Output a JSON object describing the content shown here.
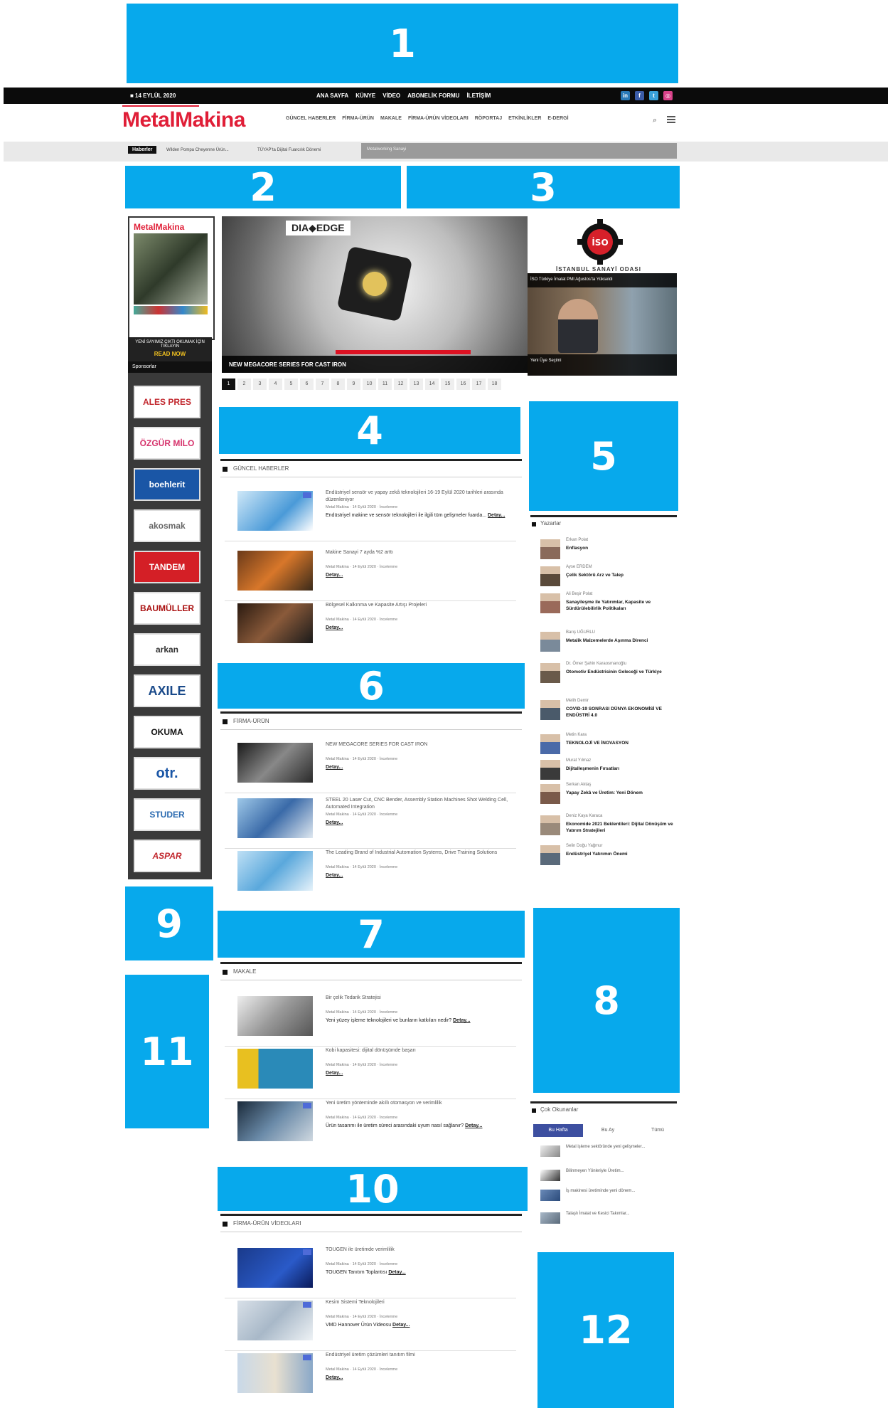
{
  "markers": [
    "1",
    "2",
    "3",
    "4",
    "5",
    "6",
    "7",
    "8",
    "9",
    "10",
    "11",
    "12"
  ],
  "colors": {
    "accent_blue": "#07a9ec",
    "brand_red": "#e01e37",
    "tab_active": "#3d4fa0"
  },
  "topbar": {
    "date": "■ 14 EYLÜL 2020",
    "nav": [
      "ANA SAYFA",
      "KÜNYE",
      "VİDEO",
      "ABONELİK FORMU",
      "İLETİŞİM"
    ],
    "social_icons": [
      "linkedin-icon",
      "facebook-icon",
      "twitter-icon",
      "instagram-icon"
    ]
  },
  "header": {
    "logo": "MetalMakina",
    "nav": [
      "GÜNCEL HABERLER",
      "FİRMA-ÜRÜN",
      "MAKALE",
      "FİRMA-ÜRÜN VİDEOLARI",
      "RÖPORTAJ",
      "ETKİNLİKLER",
      "E-DERGİ"
    ]
  },
  "ticker": {
    "label": "Haberler",
    "items": [
      "Wilden Pompa Cheyenne Ürün...",
      "TÜYAP’ta Dijital Fuarcılık Dönemi"
    ],
    "gray_text": "Metalworking Sanayi"
  },
  "magazine": {
    "title": "MetalMakina",
    "caption": "YENİ SAYIMIZ ÇIKTI OKUMAK İÇİN TIKLAYIN",
    "read": "READ NOW"
  },
  "sponsors": {
    "heading": "Sponsorlar",
    "logos": [
      "ALES PRES",
      "ÖZGÜR MİLO",
      "boehlerit",
      "akosmak",
      "TANDEM",
      "BAUMÜLLER",
      "arkan",
      "AXILE",
      "OKUMA",
      "otr.",
      "STUDER",
      "ASPAR"
    ]
  },
  "hero": {
    "brand": "DIA◆EDGE",
    "caption": "NEW MEGACORE SERIES FOR CAST IRON",
    "pages": [
      "1",
      "2",
      "3",
      "4",
      "5",
      "6",
      "7",
      "8",
      "9",
      "10",
      "11",
      "12",
      "13",
      "14",
      "15",
      "16",
      "17",
      "18"
    ]
  },
  "iso": {
    "text": "İSTANBUL SANAYİ ODASI",
    "video_title": "İSO Türkiye İmalat PMI Ağustos’ta Yükseldi",
    "video_caption": "Yeni Üye Seçimi"
  },
  "sections": {
    "guncel": {
      "heading": "GÜNCEL HABERLER",
      "articles": [
        {
          "title": "Endüstriyel sensör ve yapay zekâ teknolojileri 16-19 Eylül 2020 tarihleri arasında düzenleniyor",
          "meta": "Metal Makina  ·  14 Eylül 2020  ·  İncelenme",
          "summary": "Endüstriyel makine ve sensör teknolojileri ile ilgili tüm gelişmeler fuarda...",
          "detail": "Detay..."
        },
        {
          "title": "Makine Sanayi 7 ayda %2 arttı",
          "meta": "Metal Makina  ·  14 Eylül 2020  ·  İncelenme",
          "summary": "",
          "detail": "Detay..."
        },
        {
          "title": "Bölgesel Kalkınma ve Kapasite Artışı Projeleri",
          "meta": "Metal Makina  ·  14 Eylül 2020  ·  İncelenme",
          "summary": "",
          "detail": "Detay..."
        }
      ]
    },
    "firma": {
      "heading": "FİRMA-ÜRÜN",
      "articles": [
        {
          "title": "NEW MEGACORE SERIES FOR CAST IRON",
          "meta": "Metal Makina  ·  14 Eylül 2020  ·  İncelenme",
          "summary": "",
          "detail": "Detay..."
        },
        {
          "title": "STEEL 20 Laser Cut, CNC Bender, Assembly Station Machines Shot Welding Cell, Automated Integration",
          "meta": "Metal Makina  ·  14 Eylül 2020  ·  İncelenme",
          "summary": "",
          "detail": "Detay..."
        },
        {
          "title": "The Leading Brand of Industrial Automation Systems, Drive Training Solutions",
          "meta": "Metal Makina  ·  14 Eylül 2020  ·  İncelenme",
          "summary": "",
          "detail": "Detay..."
        }
      ]
    },
    "makale": {
      "heading": "MAKALE",
      "articles": [
        {
          "title": "Bir çelik Tedarik Stratejisi",
          "meta": "Metal Makina  ·  14 Eylül 2020  ·  İncelenme",
          "summary": "Yeni yüzey işleme teknolojileri ve bunların katkıları nedir?",
          "detail": "Detay..."
        },
        {
          "title": "Kobi kapasitesi: dijital dönüşümde başarı",
          "meta": "Metal Makina  ·  14 Eylül 2020  ·  İncelenme",
          "summary": "",
          "detail": "Detay..."
        },
        {
          "title": "Yeni üretim yönteminde akıllı otomasyon ve verimlilik",
          "meta": "Metal Makina  ·  14 Eylül 2020  ·  İncelenme",
          "summary": "Ürün tasarımı ile üretim süreci arasındaki uyum nasıl sağlanır?",
          "detail": "Detay..."
        }
      ]
    },
    "videolar": {
      "heading": "FİRMA-ÜRÜN VİDEOLARI",
      "articles": [
        {
          "title": "TOUGEN ile üretimde verimlilik",
          "meta": "Metal Makina  ·  14 Eylül 2020  ·  İncelenme",
          "summary": "TOUGEN Tanıtım Toplantısı",
          "detail": "Detay..."
        },
        {
          "title": "Kesim Sistemi Teknolojileri",
          "meta": "Metal Makina  ·  14 Eylül 2020  ·  İncelenme",
          "summary": "VMD Hannover Ürün Videosu",
          "detail": "Detay..."
        },
        {
          "title": "Endüstriyel üretim çözümleri tanıtım filmi",
          "meta": "Metal Makina  ·  14 Eylül 2020  ·  İncelenme",
          "summary": "",
          "detail": "Detay..."
        }
      ]
    }
  },
  "authors": {
    "heading": "Yazarlar",
    "items": [
      {
        "name": "Erkan Polat",
        "title": "Enflasyon"
      },
      {
        "name": "Ayse ERDEM",
        "title": "Çelik Sektörü Arz ve Talep"
      },
      {
        "name": "Ali Beşir Polat",
        "title": "Sanayileşme ile Yatırımlar, Kapasite ve Sürdürülebilirlik Politikaları"
      },
      {
        "name": "Barış UĞURLU",
        "title": "Metalik Malzemelerde Aşınma Direnci"
      },
      {
        "name": "Dr. Ömer Şahin Karaosmanoğlu",
        "title": "Otomotiv Endüstrisinin Geleceği ve Türkiye"
      },
      {
        "name": "Melih Demir",
        "title": "COVID-19 SONRASI DÜNYA EKONOMİSİ VE ENDÜSTRİ 4.0"
      },
      {
        "name": "Metin Kara",
        "title": "TEKNOLOJİ VE İNOVASYON"
      },
      {
        "name": "Murat Yılmaz",
        "title": "Dijitalleşmenin Fırsatları"
      },
      {
        "name": "Serkan Aktaş",
        "title": "Yapay Zekâ ve Üretim: Yeni Dönem"
      },
      {
        "name": "Deniz Kaya Karaca",
        "title": "Ekonomide 2021 Beklentileri: Dijital Dönüşüm ve Yatırım Stratejileri"
      },
      {
        "name": "Selin Doğu Yağmur",
        "title": "Endüstriyel Yatırımın Önemi"
      }
    ]
  },
  "mostread": {
    "heading": "Çok Okunanlar",
    "tabs": [
      "Bu Hafta",
      "Bu Ay",
      "Tümü"
    ],
    "items": [
      "Metal işleme sektöründe yeni gelişmeler...",
      "Bilinmeyen Yönleriyle Üretim...",
      "İş makinesi üretiminde yeni dönem...",
      "Talaşlı İmalat ve Kesici Takımlar..."
    ]
  }
}
